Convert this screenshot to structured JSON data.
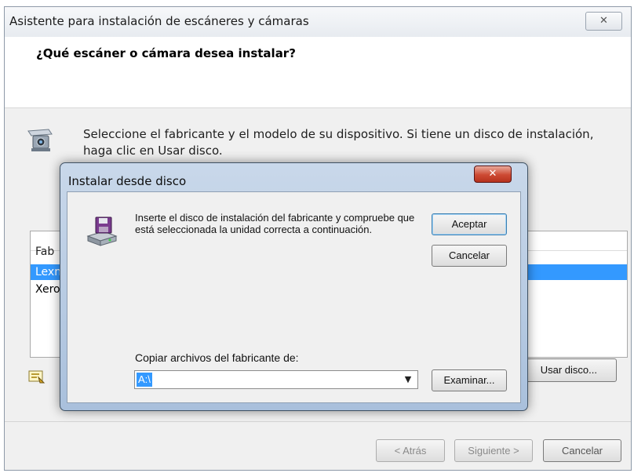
{
  "wizard": {
    "title": "Asistente para instalación de escáneres y cámaras",
    "close_glyph": "✕",
    "heading": "¿Qué escáner o cámara desea instalar?",
    "instruction": "Seleccione el fabricante y el modelo de su dispositivo. Si tiene un disco de instalación, haga clic en Usar disco.",
    "device_icon": "scanner-camera-icon",
    "list": {
      "header_partial": "Fab",
      "items": [
        "Lexn",
        "Xero"
      ],
      "selected_index": 0
    },
    "tip_icon": "info-card-icon",
    "have_disk_label": "Usar disco...",
    "back_label": "< Atrás",
    "next_label": "Siguiente >",
    "cancel_label": "Cancelar"
  },
  "dialog": {
    "title": "Instalar desde disco",
    "close_glyph": "✕",
    "icon": "disk-drive-icon",
    "message": "Inserte el disco de instalación del fabricante y compruebe que está seleccionada la unidad correcta a continuación.",
    "ok_label": "Aceptar",
    "cancel_label": "Cancelar",
    "copy_from_label": "Copiar archivos del fabricante de:",
    "copy_from_value": "A:\\",
    "browse_label": "Examinar..."
  },
  "colors": {
    "selection": "#3399ff",
    "dialog_frame": "#b7cbe3",
    "close_red": "#c8432d"
  }
}
